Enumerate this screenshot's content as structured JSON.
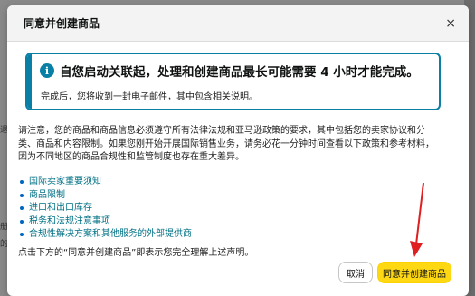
{
  "background": {
    "fragments": [
      "退",
      "册",
      "的"
    ]
  },
  "dialog": {
    "title": "同意并创建商品",
    "close_label": "×"
  },
  "alert": {
    "icon": "info-icon",
    "icon_glyph": "i",
    "title": "自您启动关联起，处理和创建商品最长可能需要 4 小时才能完成。",
    "subtitle": "完成后，您将收到一封电子邮件，其中包含相关说明。",
    "accent_color": "#0a7fa6"
  },
  "notice": {
    "lines": [
      "请注意，您的商品和商品信息必须遵守所有法律法规和亚马逊政策的要求，其中包括您的卖家协议和分",
      "类、商品和内容限制。如果您刚开始开展国际销售业务，请务必花一分钟时间查看以下政策和参考材料，",
      "因为不同地区的商品合规性和监管制度也存在重大差异。"
    ]
  },
  "links": [
    {
      "label": "国际卖家重要须知"
    },
    {
      "label": "商品限制"
    },
    {
      "label": "进口和出口库存"
    },
    {
      "label": "税务和法规注意事项"
    },
    {
      "label": "合规性解决方案和其他服务的外部提供商"
    }
  ],
  "footer_note": "点击下方的“同意并创建商品”即表示您完全理解上述声明。",
  "buttons": {
    "cancel": "取消",
    "confirm": "同意并创建商品",
    "confirm_color": "#ffd814"
  }
}
